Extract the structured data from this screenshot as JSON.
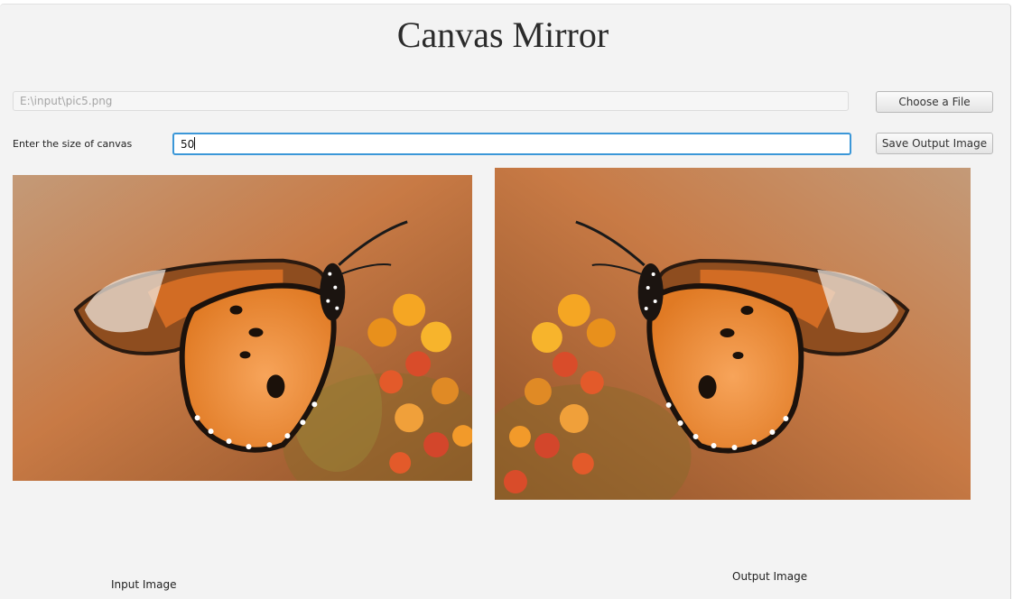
{
  "app": {
    "title": "Canvas Mirror"
  },
  "file": {
    "path": "E:\\input\\pic5.png",
    "choose_label": "Choose a File"
  },
  "canvas_size": {
    "label": "Enter the size of canvas",
    "value": "50"
  },
  "save": {
    "label": "Save Output Image"
  },
  "images": {
    "input_caption": "Input Image",
    "output_caption": "Output Image"
  },
  "colors": {
    "focus_border": "#3b97d8",
    "window_bg": "#f3f3f3"
  }
}
